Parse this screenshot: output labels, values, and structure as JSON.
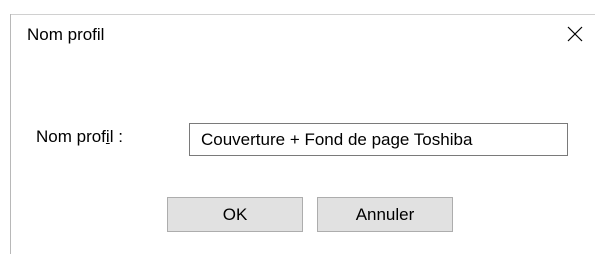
{
  "window": {
    "title": "Nom profil",
    "close_icon": "close-x-icon"
  },
  "form": {
    "label_before": "Nom prof",
    "label_underlined": "i",
    "label_after": "l :",
    "input_value": "Couverture + Fond de page Toshiba"
  },
  "buttons": {
    "ok_label": "OK",
    "cancel_label": "Annuler"
  }
}
